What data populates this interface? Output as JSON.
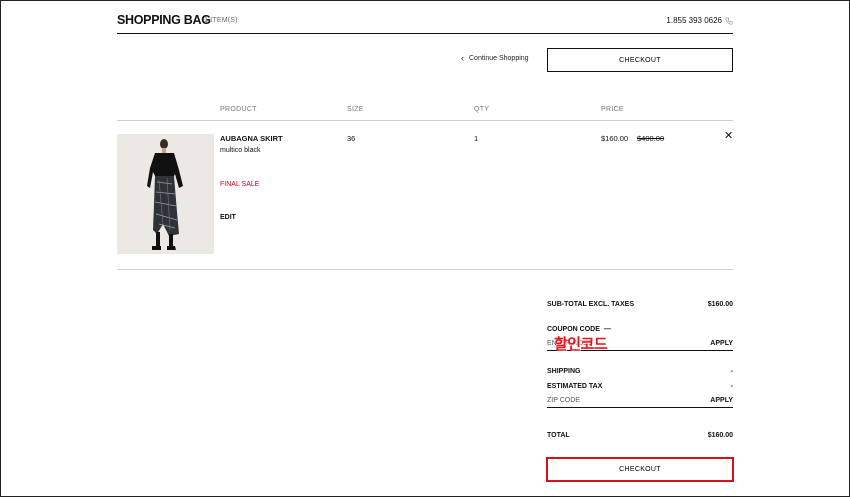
{
  "header": {
    "title": "SHOPPING BAG",
    "item_count": "1 ITEM(S)",
    "phone": "1.855 393 0626"
  },
  "nav": {
    "continue_label": "Continue Shopping",
    "checkout_label": "CHECKOUT"
  },
  "columns": {
    "product": "PRODUCT",
    "size": "SIZE",
    "qty": "QTY",
    "price": "PRICE"
  },
  "item": {
    "name": "AUBAGNA SKIRT",
    "color": "multico black",
    "sale_label": "FINAL SALE",
    "edit_label": "EDIT",
    "size": "36",
    "qty": "1",
    "price": "$160.00",
    "original_price": "$400.00"
  },
  "summary": {
    "subtotal_label": "SUB-TOTAL EXCL. TAXES",
    "subtotal_value": "$160.00",
    "coupon_label": "COUPON CODE",
    "coupon_placeholder": "ENTER CODE",
    "apply_label": "APPLY",
    "promo_overlay": "할인코드",
    "shipping_label": "SHIPPING",
    "shipping_value": "-",
    "tax_label": "ESTIMATED TAX",
    "tax_value": "-",
    "zip_placeholder": "ZIP CODE",
    "zip_apply_label": "APPLY",
    "total_label": "TOTAL",
    "total_value": "$160.00",
    "checkout_label": "CHECKOUT"
  },
  "colors": {
    "sale": "#d0021b",
    "highlight": "#d3121b"
  }
}
